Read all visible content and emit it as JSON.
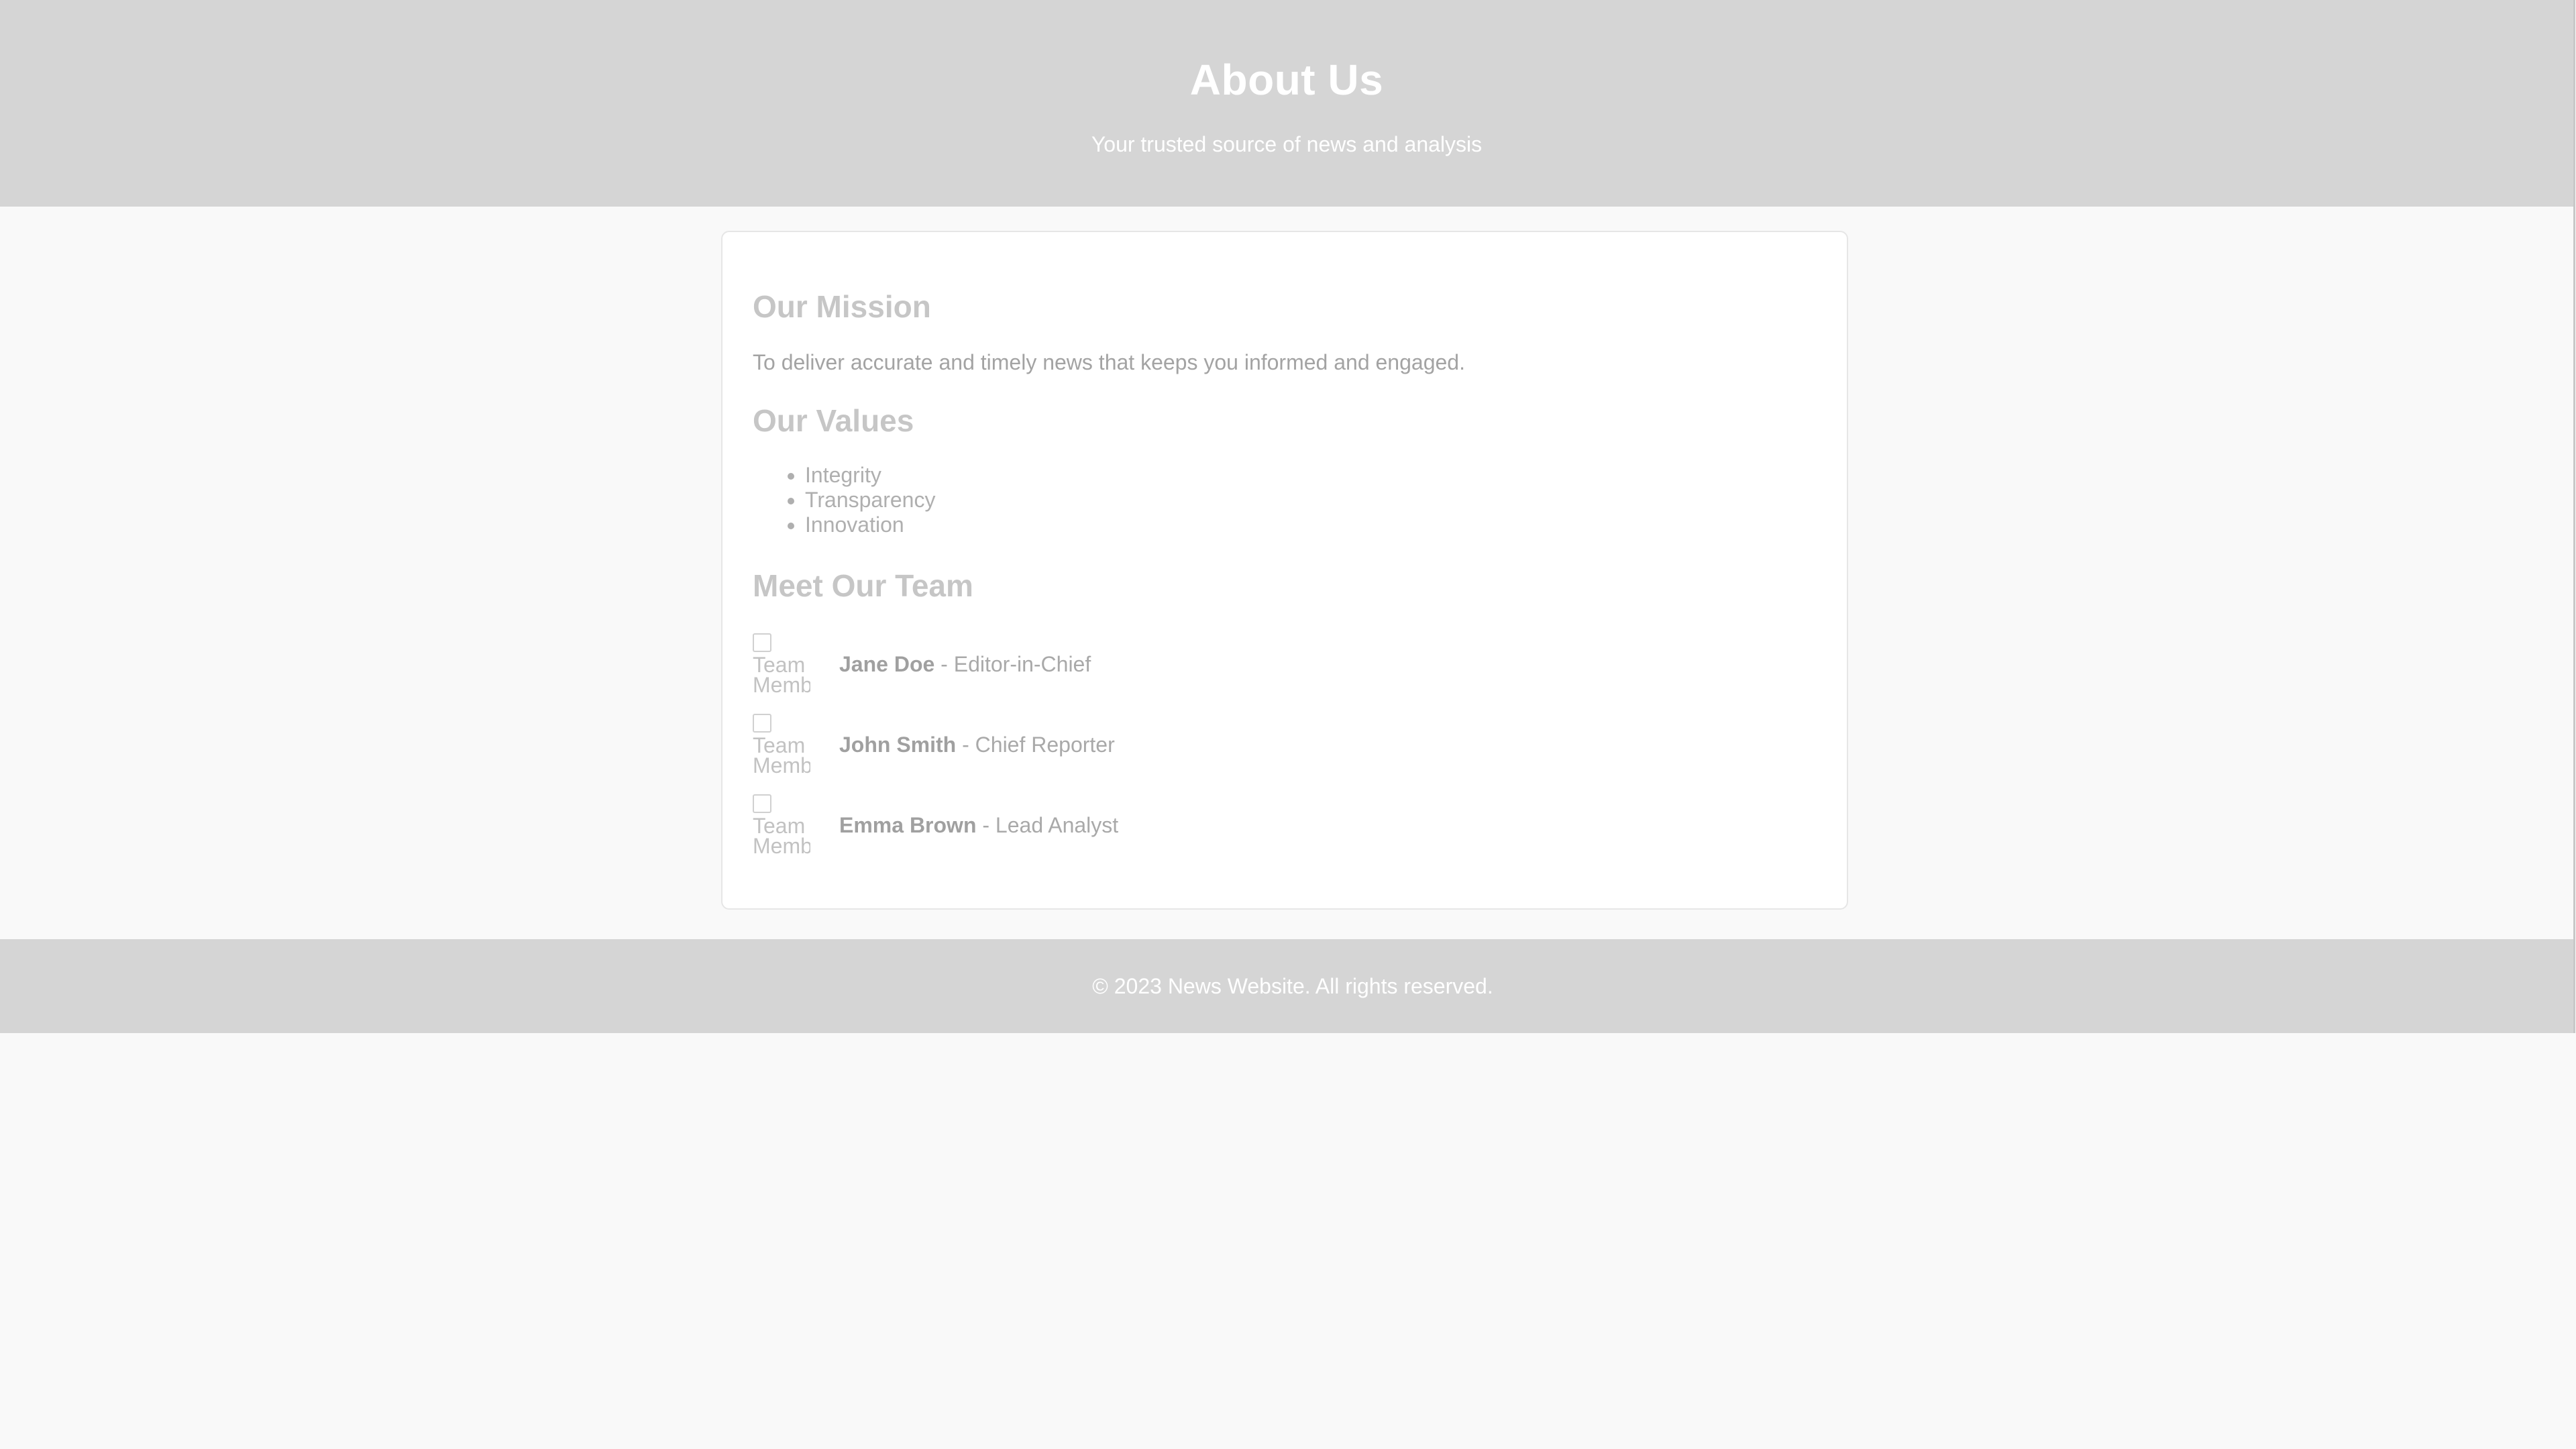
{
  "header": {
    "title": "About Us",
    "subtitle": "Your trusted source of news and analysis"
  },
  "mission": {
    "title": "Our Mission",
    "text": "To deliver accurate and timely news that keeps you informed and engaged."
  },
  "values": {
    "title": "Our Values",
    "items": [
      "Integrity",
      "Transparency",
      "Innovation"
    ]
  },
  "team": {
    "title": "Meet Our Team",
    "members": [
      {
        "name": "Jane Doe",
        "role": " - Editor-in-Chief",
        "image_alt": "Team Member"
      },
      {
        "name": "John Smith",
        "role": " - Chief Reporter",
        "image_alt": "Team Member"
      },
      {
        "name": "Emma Brown",
        "role": " - Lead Analyst",
        "image_alt": "Team Member"
      }
    ]
  },
  "footer": {
    "text": "© 2023 News Website. All rights reserved."
  },
  "colors": {
    "header_bg": "#d5d5d5",
    "page_bg": "#f9f9f9",
    "card_bg": "#ffffff"
  }
}
